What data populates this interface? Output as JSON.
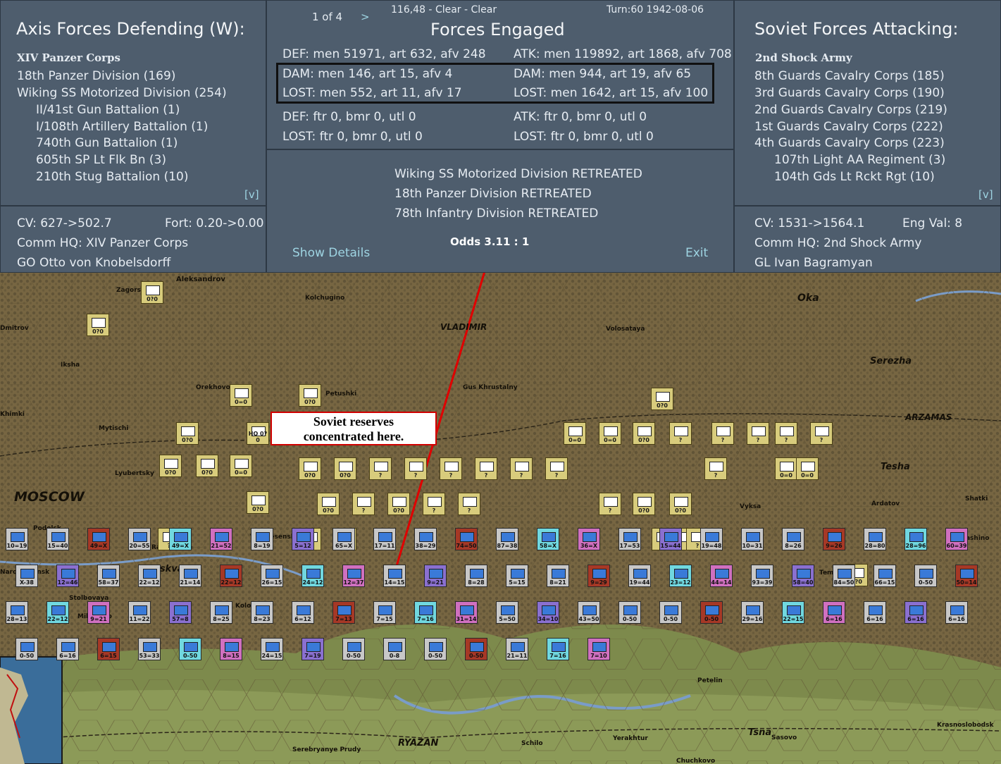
{
  "header": {
    "nav_page": "1 of 4",
    "nav_next": ">",
    "hex_info": "116,48 - Clear - Clear",
    "turn_info": "Turn:60  1942-08-06",
    "title": "Forces Engaged"
  },
  "axis": {
    "title": "Axis Forces Defending (W):",
    "corps": "XIV Panzer Corps",
    "units": [
      "18th Panzer Division (169)",
      "Wiking SS Motorized Division (254)"
    ],
    "subunits": [
      "II/41st Gun Battalion (1)",
      "I/108th Artillery Battalion (1)",
      "740th Gun Battalion (1)",
      "605th SP Lt Flk Bn (3)",
      "210th Stug Battalion (10)"
    ],
    "expand": "[v]",
    "cv": "CV: 627->502.7",
    "fort": "Fort: 0.20->0.00",
    "comm_hq": "Comm HQ: XIV Panzer Corps",
    "general": "GO Otto von Knobelsdorff"
  },
  "soviet": {
    "title": "Soviet Forces Attacking:",
    "army": "2nd Shock Army",
    "units": [
      "8th Guards Cavalry Corps (185)",
      "3rd Guards Cavalry Corps (190)",
      "2nd Guards Cavalry Corps (219)",
      "1st Guards Cavalry Corps (222)",
      "4th Guards Cavalry Corps (223)"
    ],
    "subunits": [
      "107th Light AA Regiment (3)",
      "104th Gds Lt Rckt Rgt (10)"
    ],
    "expand": "[v]",
    "cv": "CV: 1531->1564.1",
    "eng_val": "Eng Val: 8",
    "comm_hq": "Comm HQ: 2nd Shock Army",
    "general": "GL Ivan Bagramyan"
  },
  "combat": {
    "def_ground": "DEF: men 51971, art 632, afv 248",
    "atk_ground": "ATK: men 119892, art 1868, afv 708",
    "def_dam": "DAM: men 146, art 15, afv 4",
    "atk_dam": "DAM: men 944, art 19, afv 65",
    "def_lost": "LOST: men 552, art 11, afv 17",
    "atk_lost": "LOST: men 1642, art 15, afv 100",
    "def_air": "DEF: ftr 0, bmr 0, utl 0",
    "atk_air": "ATK: ftr 0, bmr 0, utl 0",
    "def_air_lost": "LOST: ftr 0, bmr 0, utl 0",
    "atk_air_lost": "LOST: ftr 0, bmr 0, utl 0",
    "results": [
      "Wiking SS Motorized Division RETREATED",
      "18th Panzer Division RETREATED",
      "78th Infantry Division RETREATED"
    ],
    "odds": "Odds 3.11 : 1",
    "show_details": "Show Details",
    "exit": "Exit"
  },
  "map": {
    "callout": [
      "Soviet reserves",
      "concentrated here."
    ],
    "cities": [
      {
        "name": "Aleksandrov"
      },
      {
        "name": "Zagorsk"
      },
      {
        "name": "Kolchugino"
      },
      {
        "name": "VLADIMIR"
      },
      {
        "name": "Volosataya"
      },
      {
        "name": "Oka"
      },
      {
        "name": "Dmitrov"
      },
      {
        "name": "Iksha"
      },
      {
        "name": "Serezha"
      },
      {
        "name": "Orekhovo"
      },
      {
        "name": "Petushki"
      },
      {
        "name": "Gus Khrustalny"
      },
      {
        "name": "Khimki"
      },
      {
        "name": "Mytischi"
      },
      {
        "name": "ARZAMAS"
      },
      {
        "name": "Lyubertsky"
      },
      {
        "name": "Tesha"
      },
      {
        "name": "MOSCOW"
      },
      {
        "name": "Vyksa"
      },
      {
        "name": "Ardatov"
      },
      {
        "name": "Shatki"
      },
      {
        "name": "Podolsk"
      },
      {
        "name": "Ramenskoe"
      },
      {
        "name": "Voskresensk"
      },
      {
        "name": "Tashino"
      },
      {
        "name": "Moskva"
      },
      {
        "name": "Naro-Fominsk"
      },
      {
        "name": "Temnik"
      },
      {
        "name": "Stolbovaya"
      },
      {
        "name": "Kolomna"
      },
      {
        "name": "Mikhnevo"
      },
      {
        "name": "Petelin"
      },
      {
        "name": "Tsna"
      },
      {
        "name": "Krasnoslobodsk"
      },
      {
        "name": "Sasovo"
      },
      {
        "name": "Serebryanye Prudy"
      },
      {
        "name": "RYAZAN"
      },
      {
        "name": "Schilo"
      },
      {
        "name": "Yerakhtur"
      },
      {
        "name": "Chuchkovo"
      }
    ],
    "axis_counters": [
      "0?0",
      "0?0",
      "0=0",
      "0?0",
      "0?0",
      "0?0",
      "0?0",
      "0=0",
      "0?0",
      "0?0",
      "?",
      "?",
      "?",
      "?",
      "?",
      "?",
      "0?0",
      "?",
      "?",
      "?",
      "?",
      "?",
      "0=0",
      "0=0",
      "0?0",
      "0?0",
      "0?0",
      "0=0",
      "0=0",
      "?",
      "0?0",
      "0?0",
      "?",
      "0?0",
      "?",
      "?",
      "?",
      "?",
      "?",
      "?",
      "?",
      "?",
      "?",
      "HQ 0?0",
      "0?0"
    ],
    "soviet_counters": [
      "10=19",
      "15=40",
      "49=X",
      "20=55",
      "49=X",
      "21=52",
      "8=19",
      "5=12",
      "65=X",
      "17=11",
      "38=29",
      "74=50",
      "87=38",
      "58=X",
      "36=X",
      "17=53",
      "15=44",
      "19=48",
      "10=31",
      "8=26",
      "9=26",
      "28=80",
      "28=96",
      "60=39",
      "X-38",
      "12=46",
      "58=37",
      "22=12",
      "21=14",
      "22=12",
      "26=15",
      "24=12",
      "12=37",
      "14=15",
      "9=21",
      "8=28",
      "5=15",
      "8=21",
      "9=29",
      "19=44",
      "23=12",
      "44=14",
      "93=39",
      "58=40",
      "84=50",
      "66=15",
      "0-50",
      "50=14",
      "28=13",
      "22=12",
      "9=21",
      "11=22",
      "57=8",
      "8=25",
      "8=23",
      "6=12",
      "7=13",
      "7=15",
      "7=16",
      "31=14",
      "5=50",
      "34=10",
      "43=50",
      "0-50",
      "0-50",
      "0-50",
      "29=16",
      "22=15",
      "6=16",
      "6=16",
      "6=16",
      "6=16",
      "0-50",
      "6=16",
      "6=15",
      "53=33",
      "0-50",
      "8=15",
      "24=15",
      "7=19",
      "0-50",
      "0-8",
      "0-50",
      "0-50",
      "21=11",
      "7=16",
      "7=10"
    ]
  },
  "colors": {
    "panel_bg": "#4e5d6d",
    "text": "#e6ecf2",
    "link": "#9ed4e2",
    "axis_counter": "#d8cc7c",
    "axis_counter_red": "#b03020",
    "soviet_counter": "#c8c8c8",
    "callout_border": "#d00000",
    "arrow": "#e00000"
  }
}
